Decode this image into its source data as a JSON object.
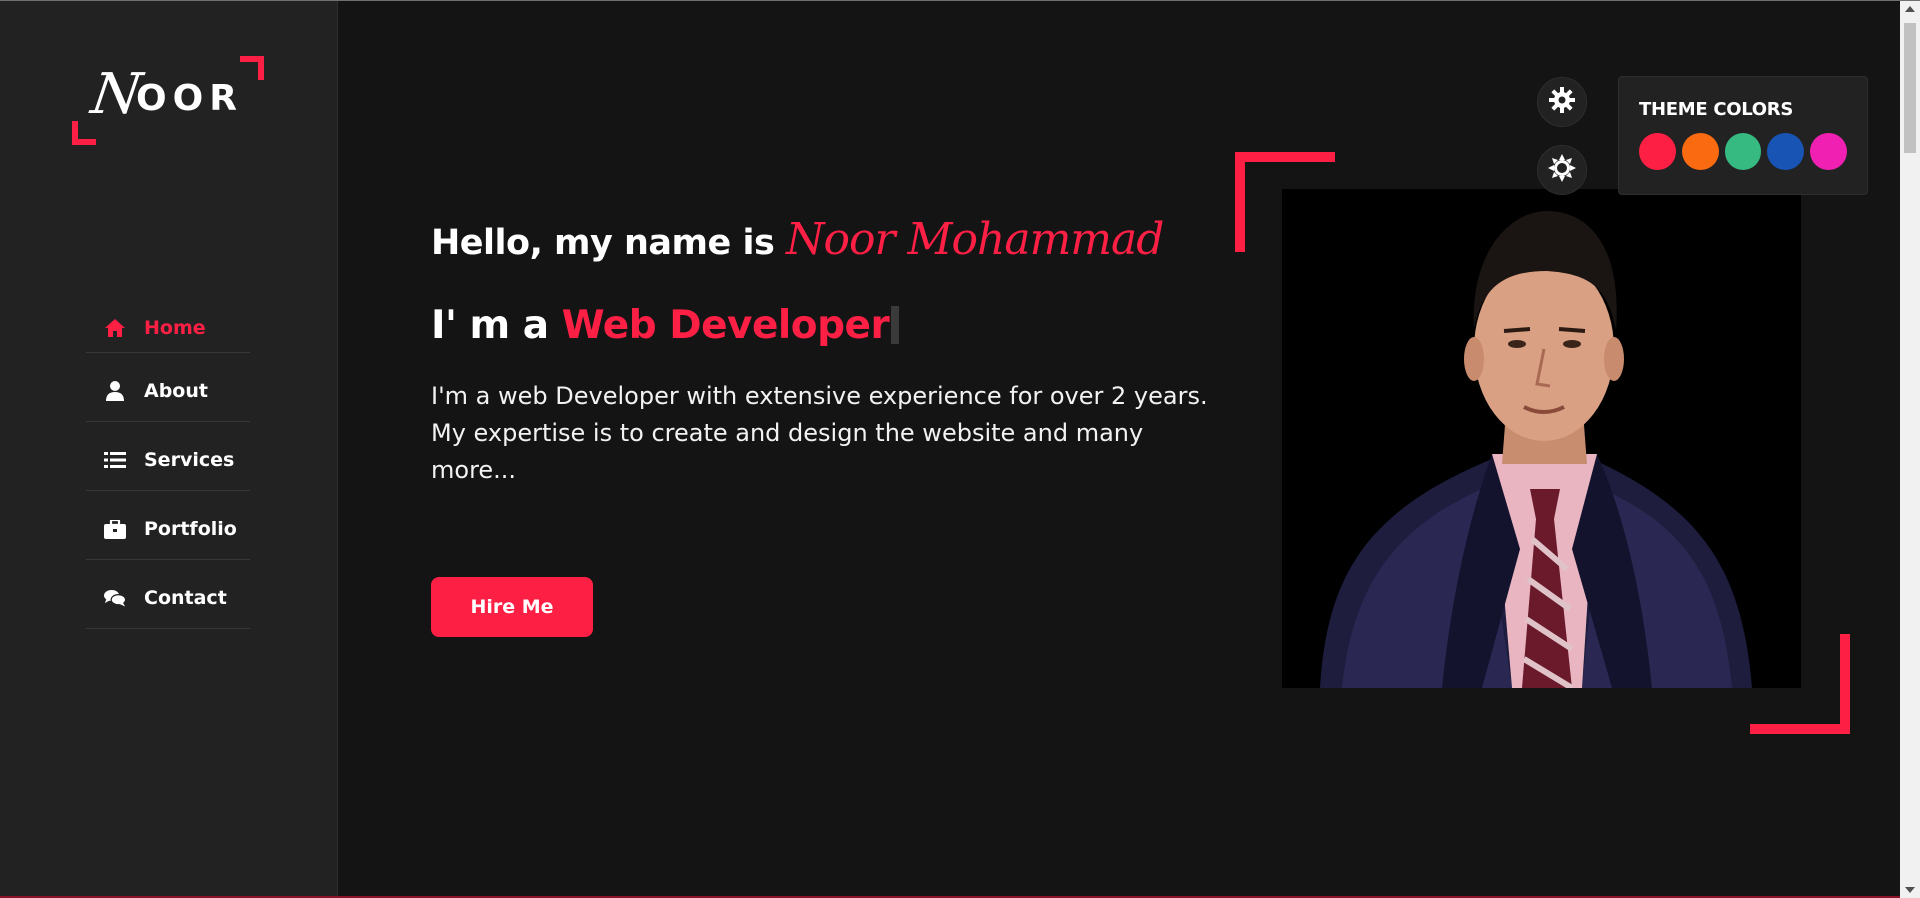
{
  "colors": {
    "accent": "#fe1f45",
    "background": "#151415",
    "sidebar": "#222222",
    "text": "#ffffff"
  },
  "logo": {
    "first_letter": "N",
    "rest": "OOR"
  },
  "nav": {
    "items": [
      {
        "label": "Home",
        "icon": "home-icon",
        "active": true
      },
      {
        "label": "About",
        "icon": "user-icon",
        "active": false
      },
      {
        "label": "Services",
        "icon": "list-icon",
        "active": false
      },
      {
        "label": "Portfolio",
        "icon": "briefcase-icon",
        "active": false
      },
      {
        "label": "Contact",
        "icon": "comments-icon",
        "active": false
      }
    ]
  },
  "hero": {
    "greeting": "Hello, my name is ",
    "name": "Noor Mohammad",
    "role_prefix": "I' m a ",
    "role": "Web Developer",
    "description": "I'm a web Developer with extensive experience for over 2 years. My expertise is to create and design the website and many more...",
    "hire_label": "Hire Me",
    "photo_icon": "profile-photo"
  },
  "style_switcher": {
    "toggle_icon": "gear-icon",
    "mode_icon": "sun-icon",
    "title": "THEME COLORS",
    "swatches": [
      "#fe1f45",
      "#fa6a10",
      "#37b982",
      "#1854b4",
      "#f021b2"
    ]
  }
}
